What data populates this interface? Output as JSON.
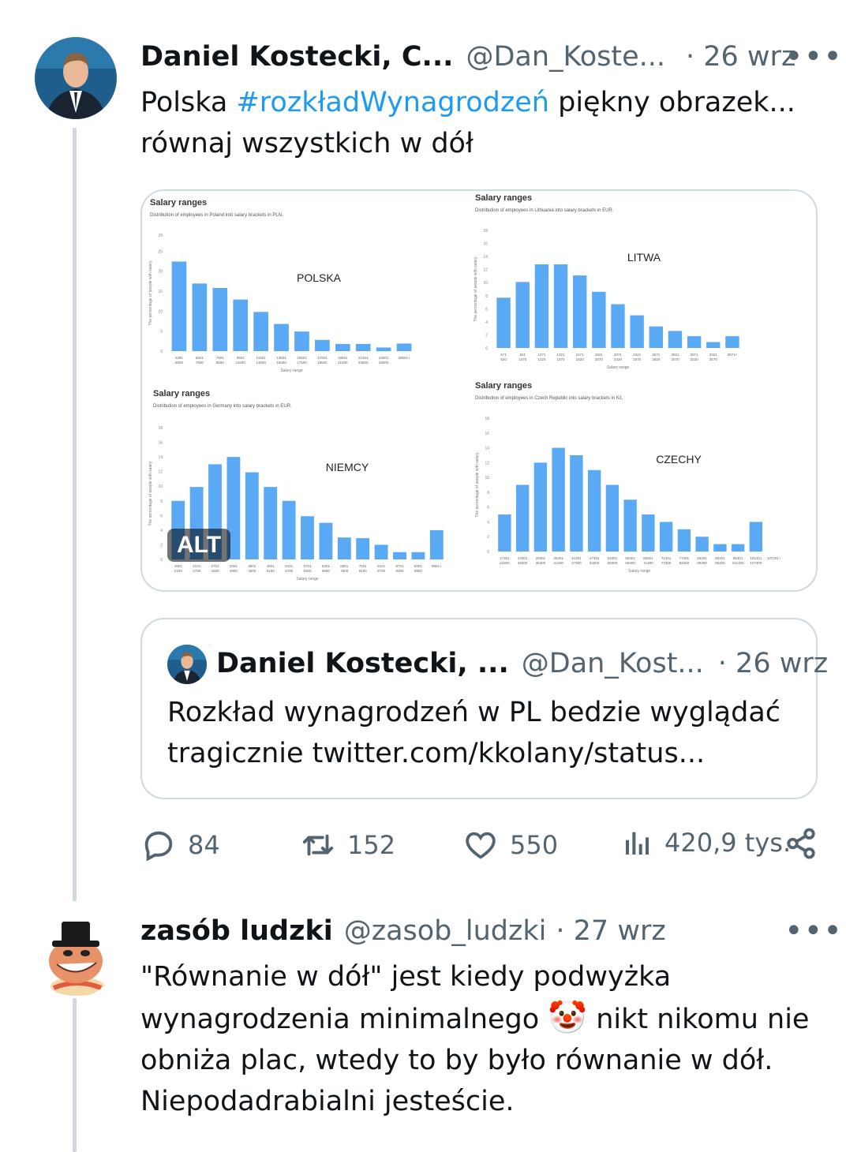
{
  "tweet": {
    "author_name": "Daniel Kostecki, C...",
    "handle": "@Dan_Koste...",
    "date": "· 26 wrz",
    "text_before": "Polska ",
    "hashtag": "#rozkładWynagrodzeń",
    "text_after": " piękny obrazek... równaj wszystkich w dół",
    "alt_label": "ALT",
    "media": {
      "charts": [
        {
          "title": "Salary ranges",
          "subtitle": "Distribution of employees in Poland into salary brackets in PLN.",
          "label": "POLSKA",
          "xlabel": "Salary range",
          "ylabel": "The percentage of people with salary",
          "yticks": [
            "0",
            "5",
            "10",
            "15",
            "20",
            "25",
            "29"
          ],
          "categories": [
            "3491 5500",
            "5501 7500",
            "7501 9500",
            "9501 11500",
            "11501 13500",
            "13501 15500",
            "15501 17500",
            "17501 19500",
            "19501 21500",
            "21501 23500",
            "23501 25500",
            "25501+"
          ],
          "values": [
            22.4,
            16.9,
            15.8,
            12.9,
            9.8,
            6.8,
            4.9,
            2.8,
            1.8,
            1.8,
            0.9,
            1.9
          ],
          "ymax": 29
        },
        {
          "title": "Salary ranges",
          "subtitle": "Distribution of employees in Lithuania into salary brackets in EUR.",
          "label": "LITWA",
          "xlabel": "Salary range",
          "ylabel": "The percentage of people with salary",
          "yticks": [
            "0",
            "2",
            "4",
            "6",
            "8",
            "10",
            "12",
            "14",
            "16",
            "18"
          ],
          "categories": [
            "571 820",
            "821 1070",
            "1071 1320",
            "1321 1570",
            "1571 1820",
            "1821 2070",
            "2071 2320",
            "2321 2570",
            "2571 2820",
            "2821 3070",
            "3071 3320",
            "3321 3570",
            "3571+"
          ],
          "values": [
            7.7,
            10.1,
            12.8,
            12.8,
            11.1,
            8.6,
            6.7,
            5.0,
            3.3,
            2.6,
            1.8,
            0.9,
            1.8
          ],
          "ymax": 18
        },
        {
          "title": "Salary ranges",
          "subtitle": "Distribution of employees in Germany into salary brackets in EUR.",
          "label": "NIEMCY",
          "xlabel": "Salary range",
          "ylabel": "The percentage of people with salary",
          "yticks": [
            "0",
            "2",
            "4",
            "6",
            "8",
            "10",
            "12",
            "14",
            "16",
            "18"
          ],
          "categories": [
            "1501 2100",
            "2101 2700",
            "2701 3300",
            "3301 3900",
            "3901 4500",
            "4501 5100",
            "5101 5700",
            "5701 6300",
            "6301 6900",
            "6901 7500",
            "7501 8100",
            "8101 8700",
            "8701 9300",
            "9301 9900",
            "9901+"
          ],
          "values": [
            8.0,
            9.9,
            13.0,
            14.0,
            11.9,
            9.9,
            8.0,
            5.9,
            5.0,
            3.0,
            2.9,
            2.0,
            1.0,
            1.0,
            4.0
          ],
          "ymax": 18
        },
        {
          "title": "Salary ranges",
          "subtitle": "Distribution of employees in Czech Republic into salary brackets in Kč.",
          "label": "CZECHY",
          "xlabel": "Salary range",
          "ylabel": "The percentage of people with salary",
          "yticks": [
            "0",
            "2",
            "4",
            "6",
            "8",
            "10",
            "12",
            "14",
            "16",
            "18"
          ],
          "categories": [
            "17301 23300",
            "23301 29300",
            "29301 35300",
            "35301 41300",
            "41301 47300",
            "47301 53300",
            "53301 59300",
            "59301 65300",
            "65301 71300",
            "71301 77300",
            "77301 83300",
            "83301 89300",
            "89301 95300",
            "95301 101300",
            "101301 107300",
            "107301+"
          ],
          "values": [
            5.0,
            9.0,
            12.0,
            14.0,
            13.0,
            11.0,
            9.0,
            7.0,
            5.0,
            4.0,
            3.0,
            2.0,
            1.0,
            1.0,
            4.0,
            null
          ],
          "ymax": 18
        }
      ]
    },
    "quote": {
      "author_name": "Daniel Kostecki, ...",
      "handle": "@Dan_Kost...",
      "date": "· 26 wrz",
      "text": "Rozkład wynagrodzeń w PL bedzie wyglądać tragicznie twitter.com/kkolany/status..."
    },
    "stats": {
      "replies": "84",
      "retweets": "152",
      "likes": "550",
      "views": "420,9 tys."
    }
  },
  "reply": {
    "author_name": "zasób ludzki",
    "handle": "@zasob_ludzki",
    "date": "· 27 wrz",
    "text_part1": "\"Równanie w dół\" jest kiedy podwyżka wynagrodzenia minimalnego",
    "emoji": "🤡",
    "text_part2": " nikt nikomu nie obniża plac, wtedy to by było równanie w dół. Niepodadrabialni jesteście."
  },
  "colors": {
    "accent": "#1d9bf0",
    "bar": "#5aa9f5",
    "secondary": "#536471",
    "border": "#cfd9de"
  }
}
